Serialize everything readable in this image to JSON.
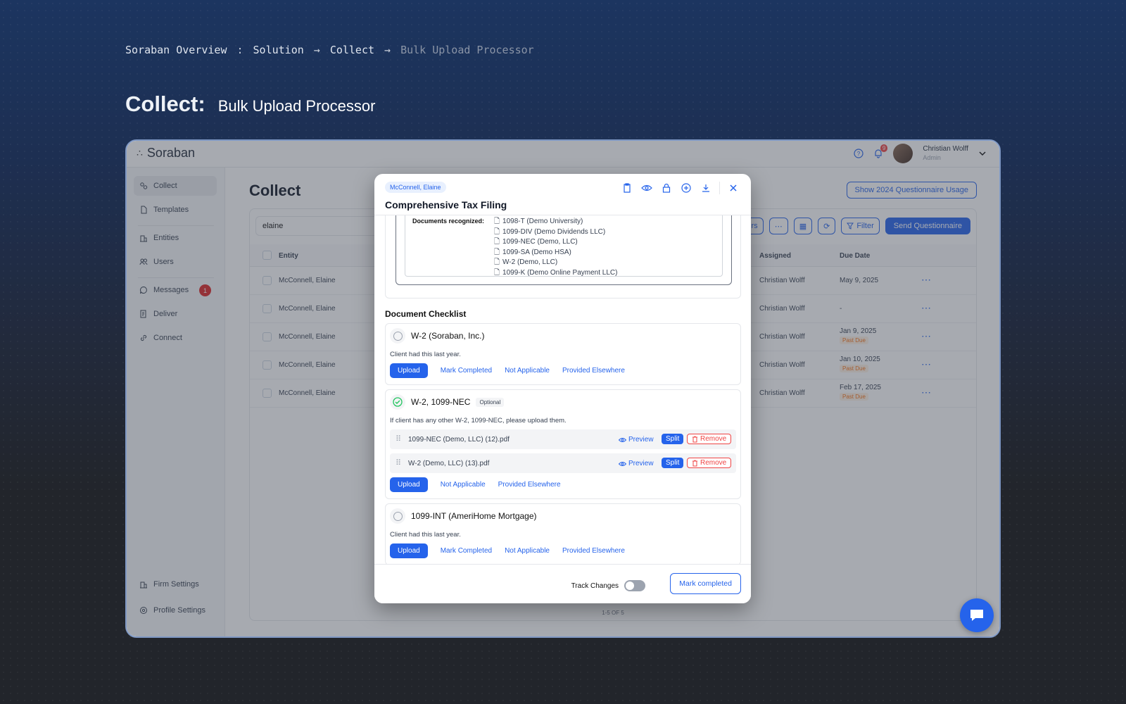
{
  "slide": {
    "breadcrumb": [
      "Soraban Overview",
      ":",
      "Solution",
      "→",
      "Collect",
      "→",
      "Bulk Upload Processor"
    ],
    "heading_bold": "Collect:",
    "heading_rest": "Bulk Upload Processor"
  },
  "app": {
    "logo": "Soraban",
    "notif_count": "9",
    "user_name": "Christian Wolff",
    "user_role": "Admin"
  },
  "sidebar": {
    "items": [
      {
        "label": "Collect",
        "icon": "collect-icon"
      },
      {
        "label": "Templates",
        "icon": "file-icon"
      },
      {
        "label": "Entities",
        "icon": "building-icon"
      },
      {
        "label": "Users",
        "icon": "users-icon"
      },
      {
        "label": "Messages",
        "icon": "chat-icon",
        "badge": "1"
      },
      {
        "label": "Deliver",
        "icon": "deliver-icon"
      },
      {
        "label": "Connect",
        "icon": "link-icon"
      }
    ],
    "bottom": [
      {
        "label": "Firm Settings",
        "icon": "building-icon"
      },
      {
        "label": "Profile Settings",
        "icon": "profile-gear-icon"
      }
    ]
  },
  "main": {
    "title": "Collect",
    "show_button": "Show 2024 Questionnaire Usage",
    "search_value": "elaine",
    "filter_label": "Filter",
    "send_label": "Send Questionnaire",
    "partial_btn": "rs",
    "columns": {
      "entity": "Entity",
      "assigned": "Assigned",
      "due": "Due Date"
    },
    "rows": [
      {
        "entity": "McConnell, Elaine",
        "assigned": "Christian Wolff",
        "due": "May 9, 2025",
        "past": ""
      },
      {
        "entity": "McConnell, Elaine",
        "assigned": "Christian Wolff",
        "due": "-",
        "past": ""
      },
      {
        "entity": "McConnell, Elaine",
        "assigned": "Christian Wolff",
        "due": "Jan 9, 2025",
        "past": "Past Due"
      },
      {
        "entity": "McConnell, Elaine",
        "assigned": "Christian Wolff",
        "due": "Jan 10, 2025",
        "past": "Past Due"
      },
      {
        "entity": "McConnell, Elaine",
        "assigned": "Christian Wolff",
        "due": "Feb 17, 2025",
        "past": "Past Due"
      }
    ],
    "pager": "1-5 OF 5"
  },
  "modal": {
    "tag": "McConnell, Elaine",
    "title": "Comprehensive Tax Filing",
    "docs_label": "Documents recognized:",
    "docs": [
      "1098-T (Demo University)",
      "1099-DIV (Demo Dividends LLC)",
      "1099-NEC (Demo, LLC)",
      "1099-SA (Demo HSA)",
      "W-2 (Demo, LLC)",
      "1099-K (Demo Online Payment LLC)"
    ],
    "checklist_title": "Document Checklist",
    "cards": [
      {
        "title": "W-2 (Soraban, Inc.)",
        "note": "Client had this last year.",
        "actions": [
          "Upload",
          "Mark Completed",
          "Not Applicable",
          "Provided Elsewhere"
        ]
      },
      {
        "title": "W-2, 1099-NEC",
        "badge": "Optional",
        "note": "If client has any other W-2, 1099-NEC, please upload them.",
        "files": [
          "1099-NEC (Demo, LLC) (12).pdf",
          "W-2 (Demo, LLC) (13).pdf"
        ],
        "actions": [
          "Upload",
          "Not Applicable",
          "Provided Elsewhere"
        ]
      },
      {
        "title": "1099-INT (AmeriHome Mortgage)",
        "note": "Client had this last year.",
        "actions": [
          "Upload",
          "Mark Completed",
          "Not Applicable",
          "Provided Elsewhere"
        ]
      }
    ],
    "file_actions": {
      "preview": "Preview",
      "split": "Split",
      "remove": "Remove"
    },
    "track_label": "Track Changes",
    "mark_completed": "Mark completed"
  }
}
